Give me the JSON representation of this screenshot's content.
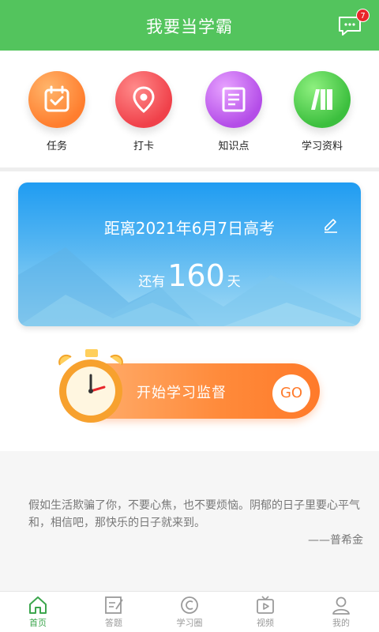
{
  "header": {
    "title": "我要当学霸",
    "badge_count": "7",
    "message_icon": "message-icon"
  },
  "quick_nav": [
    {
      "label": "任务",
      "icon": "calendar-check-icon",
      "color": "#ff7e2e"
    },
    {
      "label": "打卡",
      "icon": "location-pin-icon",
      "color": "#f0414a"
    },
    {
      "label": "知识点",
      "icon": "notebook-icon",
      "color": "#b44de8"
    },
    {
      "label": "学习资料",
      "icon": "books-icon",
      "color": "#3cbf3e"
    }
  ],
  "countdown": {
    "title": "距离2021年6月7日高考",
    "prefix": "还有",
    "days": "160",
    "suffix": "天"
  },
  "study": {
    "label": "开始学习监督",
    "go": "GO"
  },
  "quote": {
    "text": "假如生活欺骗了你，不要心焦，也不要烦恼。阴郁的日子里要心平气和，相信吧，那快乐的日子就来到。",
    "author": "——普希金"
  },
  "tabs": [
    {
      "label": "首页",
      "icon": "home-icon",
      "active": true
    },
    {
      "label": "答题",
      "icon": "answer-icon",
      "active": false
    },
    {
      "label": "学习圈",
      "icon": "study-circle-icon",
      "active": false
    },
    {
      "label": "视频",
      "icon": "video-icon",
      "active": false
    },
    {
      "label": "我的",
      "icon": "profile-icon",
      "active": false
    }
  ],
  "colors": {
    "header": "#53c45d",
    "accent": "#3ca64d",
    "badge": "#e8262b",
    "study_button": "#ff8a3a",
    "countdown_card": "#1f9cf2"
  }
}
